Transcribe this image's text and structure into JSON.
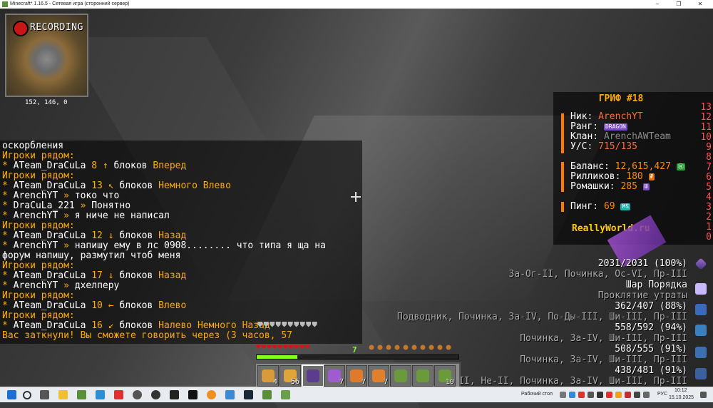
{
  "window": {
    "title": "Minecraft* 1.16.5 - Сетевая игра (сторонний сервер)",
    "controls": [
      "–",
      "❐",
      "✕"
    ]
  },
  "minimap": {
    "rec_label": "RECORDING",
    "coords": "152, 146, 0"
  },
  "chat": [
    {
      "parts": [
        {
          "t": "оскорбления",
          "c": "white"
        }
      ]
    },
    {
      "parts": [
        {
          "t": "Игроки рядом:",
          "c": "gold"
        }
      ]
    },
    {
      "parts": [
        {
          "t": " * ",
          "c": "gold"
        },
        {
          "t": "ATeam_DraCuLa",
          "c": "white"
        },
        {
          "t": " 8 ↑ ",
          "c": "gold"
        },
        {
          "t": "блоков ",
          "c": "white"
        },
        {
          "t": "Вперед",
          "c": "gold"
        }
      ]
    },
    {
      "parts": [
        {
          "t": "Игроки рядом:",
          "c": "gold"
        }
      ]
    },
    {
      "parts": [
        {
          "t": " * ",
          "c": "gold"
        },
        {
          "t": "ATeam_DraCuLa",
          "c": "white"
        },
        {
          "t": " 13 ↖ ",
          "c": "gold"
        },
        {
          "t": "блоков ",
          "c": "white"
        },
        {
          "t": "Немного Влево",
          "c": "gold"
        }
      ]
    },
    {
      "parts": [
        {
          "t": " * ",
          "c": "gold"
        },
        {
          "t": "ArenchYT",
          "c": "white"
        },
        {
          "t": " » ",
          "c": "gold"
        },
        {
          "t": "токо что",
          "c": "white"
        }
      ]
    },
    {
      "parts": [
        {
          "t": " * ",
          "c": "gold"
        },
        {
          "t": "DraCuLa_221",
          "c": "white"
        },
        {
          "t": " » ",
          "c": "gold"
        },
        {
          "t": "Понятно",
          "c": "white"
        }
      ]
    },
    {
      "parts": [
        {
          "t": " * ",
          "c": "gold"
        },
        {
          "t": "ArenchYT",
          "c": "white"
        },
        {
          "t": " » ",
          "c": "gold"
        },
        {
          "t": "я ниче не написал",
          "c": "white"
        }
      ]
    },
    {
      "parts": [
        {
          "t": "Игроки рядом:",
          "c": "gold"
        }
      ]
    },
    {
      "parts": [
        {
          "t": " * ",
          "c": "gold"
        },
        {
          "t": "ATeam_DraCuLa",
          "c": "white"
        },
        {
          "t": " 12 ↓ ",
          "c": "gold"
        },
        {
          "t": "блоков ",
          "c": "white"
        },
        {
          "t": "Назад",
          "c": "gold"
        }
      ]
    },
    {
      "parts": [
        {
          "t": " * ",
          "c": "gold"
        },
        {
          "t": "ArenchYT",
          "c": "white"
        },
        {
          "t": " » ",
          "c": "gold"
        },
        {
          "t": "напишу ему в лс 0908........ что типа я ща на",
          "c": "white"
        }
      ]
    },
    {
      "parts": [
        {
          "t": " форум напишу, размутил чтоб меня",
          "c": "white"
        }
      ]
    },
    {
      "parts": [
        {
          "t": "Игроки рядом:",
          "c": "gold"
        }
      ]
    },
    {
      "parts": [
        {
          "t": " * ",
          "c": "gold"
        },
        {
          "t": "ATeam_DraCuLa",
          "c": "white"
        },
        {
          "t": " 17 ↓ ",
          "c": "gold"
        },
        {
          "t": "блоков ",
          "c": "white"
        },
        {
          "t": "Назад",
          "c": "gold"
        }
      ]
    },
    {
      "parts": [
        {
          "t": " * ",
          "c": "gold"
        },
        {
          "t": "ArenchYT",
          "c": "white"
        },
        {
          "t": " » ",
          "c": "gold"
        },
        {
          "t": "дхелперу",
          "c": "white"
        }
      ]
    },
    {
      "parts": [
        {
          "t": "Игроки рядом:",
          "c": "gold"
        }
      ]
    },
    {
      "parts": [
        {
          "t": " * ",
          "c": "gold"
        },
        {
          "t": "ATeam_DraCuLa",
          "c": "white"
        },
        {
          "t": " 10 ← ",
          "c": "gold"
        },
        {
          "t": "блоков ",
          "c": "white"
        },
        {
          "t": "Влево",
          "c": "gold"
        }
      ]
    },
    {
      "parts": [
        {
          "t": "Игроки рядом:",
          "c": "gold"
        }
      ]
    },
    {
      "parts": [
        {
          "t": " * ",
          "c": "gold"
        },
        {
          "t": "ATeam_DraCuLa",
          "c": "white"
        },
        {
          "t": " 16 ↙ ",
          "c": "gold"
        },
        {
          "t": "блоков ",
          "c": "white"
        },
        {
          "t": "Налево Немного Назад",
          "c": "gold"
        }
      ]
    },
    {
      "parts": [
        {
          "t": "Вас заткнули! Вы сможете говорить через (3 часов, 57",
          "c": "gold"
        }
      ]
    }
  ],
  "scoreboard": {
    "title": "ГРИФ #18",
    "numbers": [
      "13",
      "12",
      "11",
      "10",
      "9",
      "8",
      "7",
      "6",
      "5",
      "4",
      "3",
      "2",
      "1",
      "0"
    ],
    "nick_label": "Ник:",
    "nick": "ArenchYT",
    "rank_label": "Ранг:",
    "rank": "DRAGON",
    "clan_label": "Клан:",
    "clan": "ArenchAWTeam",
    "kd_label": "У/С:",
    "kd": "715/135",
    "balance_label": "Баланс:",
    "balance": "12,615,427",
    "balance_badge": "Ⓡ",
    "rillik_label": "Рилликов:",
    "rillik": "180",
    "rillik_badge": "₽",
    "romashki_label": "Ромашки:",
    "romashki": "285",
    "romashki_badge": "Ш",
    "ping_label": "Пинг:",
    "ping": "69",
    "ping_badge": "MS",
    "site": "ReallyWorld.ru"
  },
  "items": [
    {
      "text": "2031/2031 (100%)",
      "color": "#ffffff"
    },
    {
      "text": "За-Ог-II, Починка, Ос-VI, Пр-III",
      "color": "#aaaaaa"
    },
    {
      "text": "Шар Порядка",
      "color": "#ffffff"
    },
    {
      "text": "Проклятие утраты",
      "color": "#aaaaaa"
    },
    {
      "text": "362/407 (88%)",
      "color": "#ffffff"
    },
    {
      "text": "Подводник, Починка, За-IV, По-Ды-III, Ши-III, Пр-III",
      "color": "#aaaaaa"
    },
    {
      "text": "558/592 (94%)",
      "color": "#ffffff"
    },
    {
      "text": "Починка, За-IV, Ши-III, Пр-III",
      "color": "#aaaaaa"
    },
    {
      "text": "508/555 (91%)",
      "color": "#ffffff"
    },
    {
      "text": "Починка, За-IV, Ши-III, Пр-III",
      "color": "#aaaaaa"
    },
    {
      "text": "438/481 (91%)",
      "color": "#ffffff"
    },
    {
      "text": "Ло-III, Не-II, Починка, За-IV, Ши-III, Пр-III",
      "color": "#aaaaaa"
    }
  ],
  "hud": {
    "xp_level": "7",
    "hearts": "♥♥♥♥♥♥♥♥♥♥",
    "hunger": "🍗🍗🍗🍗🍗🍗🍗🍗🍗🍗",
    "armor": "⛊⛊⛊⛊⛊⛊⛊⛊⛊⛊"
  },
  "hotbar": [
    {
      "name": "golden-apple",
      "count": "4",
      "color": "#d89a3a"
    },
    {
      "name": "golden-apple-stack",
      "count": "56",
      "color": "#e0a53a"
    },
    {
      "name": "netherite-sword",
      "count": "",
      "color": "#5b3c8f"
    },
    {
      "name": "potion-purple",
      "count": "7",
      "color": "#a05bd0"
    },
    {
      "name": "potion-orange",
      "count": "7",
      "color": "#e07a2a"
    },
    {
      "name": "potion-orange-2",
      "count": "7",
      "color": "#e0802a"
    },
    {
      "name": "turtle-helmet",
      "count": "",
      "color": "#6a9a3a"
    },
    {
      "name": "turtle-helmet-2",
      "count": "",
      "color": "#6a9a3a"
    },
    {
      "name": "turtle-helmet-3",
      "count": "10",
      "color": "#6a9a3a"
    }
  ],
  "taskbar": {
    "desktop": "Рабочий стол",
    "lang": "РУС",
    "time": "10:12",
    "date": "15.10.2025"
  }
}
